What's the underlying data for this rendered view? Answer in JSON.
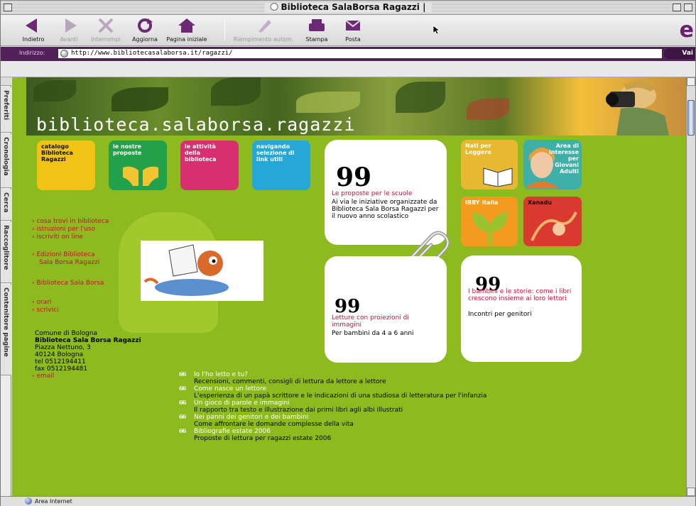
{
  "window": {
    "title": "Biblioteca SalaBorsa Ragazzi |"
  },
  "toolbar": {
    "buttons": [
      {
        "label": "Indietro",
        "icon": "back-arrow-icon"
      },
      {
        "label": "Avanti",
        "icon": "forward-arrow-icon"
      },
      {
        "label": "Interrompi",
        "icon": "stop-icon"
      },
      {
        "label": "Aggiorna",
        "icon": "refresh-icon"
      },
      {
        "label": "Pagina iniziale",
        "icon": "home-icon"
      },
      {
        "label": "Riempimento autom.",
        "icon": "autofill-icon"
      },
      {
        "label": "Stampa",
        "icon": "print-icon"
      },
      {
        "label": "Posta",
        "icon": "mail-icon"
      }
    ]
  },
  "address": {
    "label": "Indirizzo:",
    "url": "http://www.bibliotecasalaborsa.it/ragazzi/",
    "go": "Vai"
  },
  "explorer": {
    "tabs": [
      "Preferiti",
      "Cronologia",
      "Cerca",
      "Raccoglitore",
      "Contenitore pagine"
    ]
  },
  "status": {
    "zone": "Area Internet"
  },
  "site": {
    "banner_title": "biblioteca.salaborsa.ragazzi",
    "tiles": [
      {
        "label": "catalogo\nBiblioteca\nRagazzi"
      },
      {
        "label": "le nostre\nproposte"
      },
      {
        "label": "le attività\ndella\nbiblioteca"
      },
      {
        "label": "navigando\nselezione di\nlink utili"
      }
    ],
    "menu_a": [
      "cosa trovi in biblioteca",
      "istruzioni per l'uso",
      "iscriviti on line"
    ],
    "menu_b": [
      "Edizioni Biblioteca",
      "Sala Borsa Ragazzi"
    ],
    "menu_c": [
      "Biblioteca Sala Borsa"
    ],
    "menu_d": [
      "orari",
      "scrivici"
    ],
    "contact": {
      "lines": [
        "Comune di Bologna",
        "Biblioteca Sala Borsa Ragazzi",
        "Piazza Nettuno, 3",
        "40124 Bologna",
        "tel 0512194411",
        "fax 0512194481"
      ],
      "email": "email"
    },
    "card1": {
      "title": "Le proposte per le scuole",
      "body": "Ai via le iniziative organizzate da Biblioteca Sala Borsa Ragazzi per il nuovo anno scolastico"
    },
    "card2": {
      "title": "Letture con proiezioni di immagini",
      "body": "Per bambini da 4 a 6 anni"
    },
    "card3": {
      "title": "I bambini e le storie: come i libri crescono insieme ai loro lettori",
      "body": "Incontri per genitori"
    },
    "right_tiles": [
      {
        "label": "Nati per\nLeggere"
      },
      {
        "label": "Area di\ninteresse\nper\nGiovani\nAdulti"
      },
      {
        "label": "IBBY Italia"
      },
      {
        "label": "Xanadu"
      }
    ],
    "links": [
      {
        "title": "Io l'ho letto e tu?",
        "desc": "Recensioni, commenti, consigli di lettura da lettore a lettore"
      },
      {
        "title": "Come nasce un lettore",
        "desc": "L'esperienza di un papà scrittore e le indicazioni di una studiosa di letteratura per l'infanzia"
      },
      {
        "title": "Un gioco di parole e immagini",
        "desc": "Il rapporto tra testo e illustrazione dai primi libri agli albi illustrati"
      },
      {
        "title": "Nei panni dei genitori e dei bambini",
        "desc": "Come affrontare le domande complesse della vita"
      },
      {
        "title": "Bibliografie estate 2006",
        "desc": "Proposte di lettura per ragazzi estate 2006"
      }
    ]
  }
}
